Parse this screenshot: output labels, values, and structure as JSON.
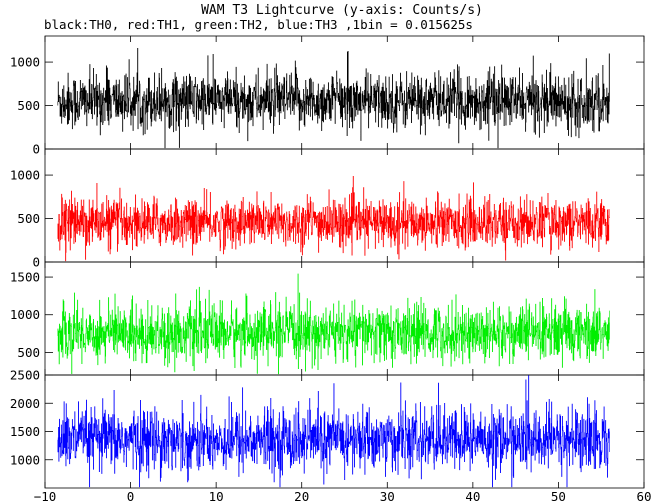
{
  "chart_data": {
    "type": "line",
    "title": "WAM T3 Lightcurve (y-axis: Counts/s)",
    "subtitle": "black:TH0, red:TH1, green:TH2, blue:TH3 ,1bin = 0.015625s",
    "xlabel": "",
    "ylabel": "",
    "xlim": [
      -10,
      60
    ],
    "x_ticks": [
      -10,
      0,
      10,
      20,
      30,
      40,
      50,
      60
    ],
    "x_data_range": [
      -8.5,
      56
    ],
    "bin_size_s": 0.015625,
    "grid": false,
    "panels": [
      {
        "name": "TH0",
        "color": "#000000",
        "ylim": [
          0,
          1300
        ],
        "y_ticks": [
          0,
          500,
          1000
        ],
        "mean": 550,
        "std": 160
      },
      {
        "name": "TH1",
        "color": "#ff0000",
        "ylim": [
          0,
          1300
        ],
        "y_ticks": [
          0,
          500,
          1000
        ],
        "mean": 450,
        "std": 140
      },
      {
        "name": "TH2",
        "color": "#00ee00",
        "ylim": [
          200,
          1700
        ],
        "y_ticks": [
          500,
          1000,
          1500
        ],
        "mean": 760,
        "std": 190
      },
      {
        "name": "TH3",
        "color": "#0000ff",
        "ylim": [
          500,
          2500
        ],
        "y_ticks": [
          1000,
          1500,
          2000,
          2500
        ],
        "mean": 1350,
        "std": 280
      }
    ]
  }
}
